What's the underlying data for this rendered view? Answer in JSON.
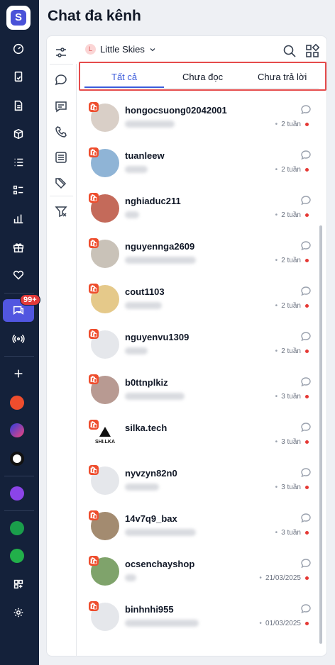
{
  "app": {
    "title": "Chat đa kênh",
    "logo_letter": "S"
  },
  "rail": {
    "badge": "99+",
    "icons": [
      "dashboard-icon",
      "orders-icon",
      "document-icon",
      "package-icon",
      "list-icon",
      "checklist-icon",
      "chart-icon",
      "gift-icon",
      "heart-icon",
      "chat-icon",
      "broadcast-icon",
      "plus-icon",
      "shopee-icon",
      "lazada-icon",
      "tiktok-icon",
      "connect-icon",
      "shop-icon",
      "brand-icon",
      "apps-icon",
      "settings-icon"
    ]
  },
  "shop_selector": {
    "avatar_letter": "L",
    "name": "Little Skies"
  },
  "tabs": [
    {
      "label": "Tất cả",
      "active": true
    },
    {
      "label": "Chưa đọc",
      "active": false
    },
    {
      "label": "Chưa trả lời",
      "active": false
    }
  ],
  "conversations": [
    {
      "name": "hongocsuong02042001",
      "time": "2 tuần",
      "avatar_color": "#d9cfc7"
    },
    {
      "name": "tuanleew",
      "time": "2 tuần",
      "avatar_color": "#8fb4d6"
    },
    {
      "name": "nghiaduc211",
      "time": "2 tuần",
      "avatar_color": "#c46a5a"
    },
    {
      "name": "nguyennga2609",
      "time": "2 tuần",
      "avatar_color": "#c9c2b8"
    },
    {
      "name": "cout1103",
      "time": "2 tuần",
      "avatar_color": "#e5c98a"
    },
    {
      "name": "nguyenvu1309",
      "time": "2 tuần",
      "avatar_color": "#e5e7eb"
    },
    {
      "name": "b0ttnplkiz",
      "time": "3 tuần",
      "avatar_color": "#b89a92"
    },
    {
      "name": "silka.tech",
      "time": "3 tuần",
      "avatar_color": "#ffffff",
      "logo_text": "SHI.LKA"
    },
    {
      "name": "nyvzyn82n0",
      "time": "3 tuần",
      "avatar_color": "#e5e7eb"
    },
    {
      "name": "14v7q9_bax",
      "time": "3 tuần",
      "avatar_color": "#a38b70"
    },
    {
      "name": "ocsenchayshop",
      "time": "21/03/2025",
      "avatar_color": "#7fa36b"
    },
    {
      "name": "binhnhi955",
      "time": "01/03/2025",
      "avatar_color": "#e5e7eb"
    }
  ]
}
